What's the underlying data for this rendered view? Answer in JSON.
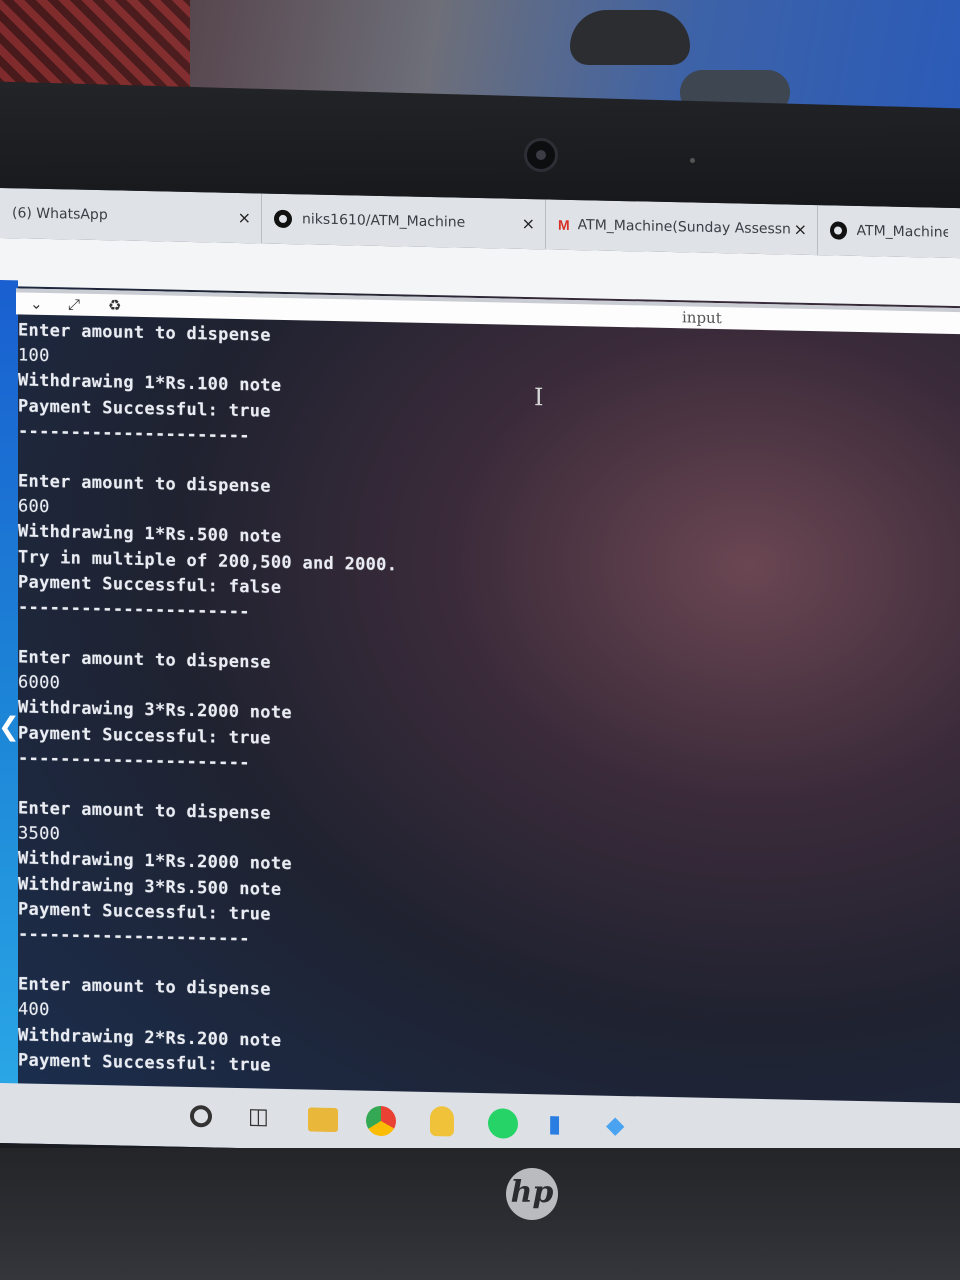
{
  "browser": {
    "tabs": [
      {
        "label": "(6) WhatsApp",
        "icon": "whatsapp-icon"
      },
      {
        "label": "niks1610/ATM_Machine",
        "icon": "github-icon"
      },
      {
        "label": "ATM_Machine(Sunday Assessn",
        "icon": "gmail-icon"
      },
      {
        "label": "ATM_Machine/",
        "icon": "github-icon"
      }
    ],
    "close_glyph": "×"
  },
  "panel": {
    "input_label": "input"
  },
  "console": {
    "prompt": "Enter amount to dispense",
    "result_prefix": "Payment Successful: ",
    "separator": "----------------------",
    "blocks": [
      {
        "amount": "100",
        "lines": [
          "Withdrawing 1*Rs.100 note"
        ],
        "result": "Payment Successful: true"
      },
      {
        "amount": "600",
        "lines": [
          "Withdrawing 1*Rs.500 note",
          "Try in multiple of 200,500 and 2000."
        ],
        "result": "Payment Successful: false"
      },
      {
        "amount": "6000",
        "lines": [
          "Withdrawing 3*Rs.2000 note"
        ],
        "result": "Payment Successful: true"
      },
      {
        "amount": "3500",
        "lines": [
          "Withdrawing 1*Rs.2000 note",
          "Withdrawing 3*Rs.500 note"
        ],
        "result": "Payment Successful: true"
      },
      {
        "amount": "400",
        "lines": [
          "Withdrawing 2*Rs.200 note"
        ],
        "result": "Payment Successful: true"
      }
    ]
  },
  "taskbar": {
    "apps": [
      "search-icon",
      "task-view-icon",
      "file-explorer-icon",
      "chrome-icon",
      "people-icon",
      "whatsapp-icon",
      "app-icon",
      "app-icon"
    ]
  },
  "device": {
    "brand_logo": "hp"
  },
  "colors": {
    "console_text": "#e9ecf2",
    "sidebar_accent": "#1c83d6",
    "tabstrip": "#dfe3e8"
  }
}
